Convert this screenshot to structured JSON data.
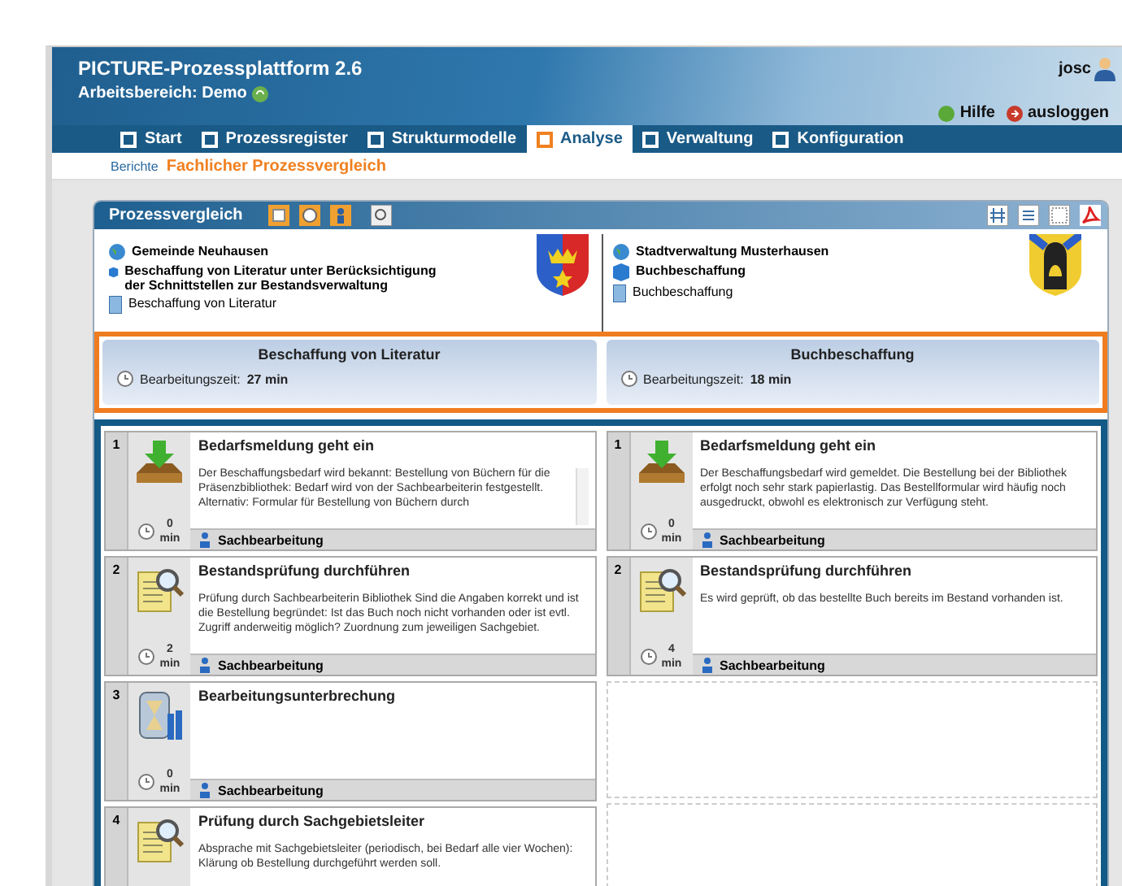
{
  "header": {
    "title": "PICTURE-Prozessplattform 2.6",
    "workspace": "Arbeitsbereich: Demo",
    "user": "josc",
    "help": "Hilfe",
    "logout": "ausloggen"
  },
  "nav": [
    {
      "label": "Start",
      "selected": false
    },
    {
      "label": "Prozessregister",
      "selected": false
    },
    {
      "label": "Strukturmodelle",
      "selected": false
    },
    {
      "label": "Analyse",
      "selected": true
    },
    {
      "label": "Verwaltung",
      "selected": false
    },
    {
      "label": "Konfiguration",
      "selected": false
    }
  ],
  "breadcrumb": {
    "parent": "Berichte",
    "current": "Fachlicher Prozessvergleich"
  },
  "panel": {
    "title": "Prozessvergleich",
    "processes": [
      {
        "organisation": "Gemeinde Neuhausen",
        "process": "Beschaffung von Literatur unter Berücksichtigung der Schnittstellen zur Bestandsverwaltung",
        "variant": "Beschaffung von Literatur"
      },
      {
        "organisation": "Stadtverwaltung Musterhausen",
        "process": "Buchbeschaffung",
        "variant": "Buchbeschaffung"
      }
    ],
    "summary": [
      {
        "name": "Beschaffung von Literatur",
        "time_label": "Bearbeitungszeit:",
        "time": "27 min"
      },
      {
        "name": "Buchbeschaffung",
        "time_label": "Bearbeitungszeit:",
        "time": "18 min"
      }
    ],
    "columns": [
      {
        "steps": [
          {
            "kind": "request",
            "number": "1",
            "title": "Bedarfsmeldung geht ein",
            "description": "Der Beschaffungsbedarf wird bekannt: Bestellung von Büchern für die Präsenzbibliothek: Bedarf wird von der Sachbearbeiterin festgestellt. Alternativ: Formular für Bestellung von Büchern durch",
            "scrollable": true,
            "minutes": "0",
            "unit": "min",
            "role": "Sachbearbeitung"
          },
          {
            "kind": "check",
            "number": "2",
            "title": "Bestandsprüfung durchführen",
            "description": "Prüfung durch Sachbearbeiterin Bibliothek Sind die Angaben korrekt und ist die Bestellung begründet: Ist das Buch noch nicht vorhanden oder ist evtl. Zugriff anderweitig möglich? Zuordnung zum jeweiligen Sachgebiet.",
            "scrollable": false,
            "minutes": "2",
            "unit": "min",
            "role": "Sachbearbeitung"
          },
          {
            "kind": "pause",
            "number": "3",
            "title": "Bearbeitungsunterbrechung",
            "scrollable": false,
            "minutes": "0",
            "unit": "min",
            "role": "Sachbearbeitung"
          },
          {
            "kind": "check",
            "number": "4",
            "title": "Prüfung durch Sachgebietsleiter",
            "description": "Absprache mit Sachgebietsleiter (periodisch, bei Bedarf alle vier Wochen): Klärung ob Bestellung durchgeführt werden soll.",
            "scrollable": false
          }
        ]
      },
      {
        "steps": [
          {
            "kind": "request",
            "number": "1",
            "title": "Bedarfsmeldung geht ein",
            "description": "Der Beschaffungsbedarf wird gemeldet. Die Bestellung bei der Bibliothek erfolgt noch sehr stark papierlastig. Das Bestellformular wird häufig noch ausgedruckt, obwohl es elektronisch zur Verfügung steht.",
            "scrollable": false,
            "minutes": "0",
            "unit": "min",
            "role": "Sachbearbeitung"
          },
          {
            "kind": "check",
            "number": "2",
            "title": "Bestandsprüfung durchführen",
            "description": "Es wird geprüft, ob das bestellte Buch bereits im Bestand vorhanden ist.",
            "scrollable": false,
            "minutes": "4",
            "unit": "min",
            "role": "Sachbearbeitung"
          },
          {
            "kind": "empty"
          },
          {
            "kind": "empty"
          }
        ]
      }
    ]
  }
}
